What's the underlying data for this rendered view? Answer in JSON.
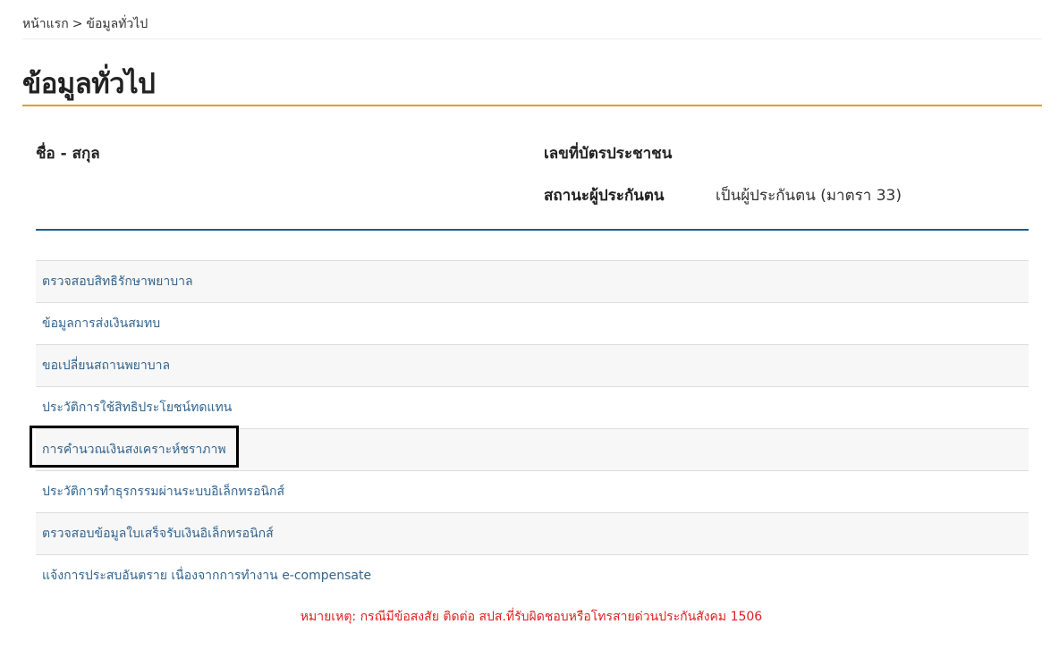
{
  "breadcrumb": {
    "home": "หน้าแรก",
    "separator": ">",
    "current": "ข้อมูลทั่วไป"
  },
  "page_title": "ข้อมูลทั่วไป",
  "info": {
    "name_label": "ชื่อ - สกุล",
    "name_value": "",
    "id_label": "เลขที่บัตรประชาชน",
    "id_value": "",
    "status_label": "สถานะผู้ประกันตน",
    "status_value": "เป็นผู้ประกันตน (มาตรา 33)"
  },
  "menu": [
    {
      "label": "ตรวจสอบสิทธิรักษาพยาบาล"
    },
    {
      "label": "ข้อมูลการส่งเงินสมทบ"
    },
    {
      "label": "ขอเปลี่ยนสถานพยาบาล"
    },
    {
      "label": "ประวัติการใช้สิทธิประโยชน์ทดแทน"
    },
    {
      "label": "การคำนวณเงินสงเคราะห์ชราภาพ"
    },
    {
      "label": "ประวัติการทำธุรกรรมผ่านระบบอิเล็กทรอนิกส์"
    },
    {
      "label": "ตรวจสอบข้อมูลใบเสร็จรับเงินอิเล็กทรอนิกส์"
    },
    {
      "label": "แจ้งการประสบอันตราย เนื่องจากการทำงาน e-compensate"
    }
  ],
  "note": "หมายเหตุ: กรณีมีข้อสงสัย ติดต่อ สปส.ที่รับผิดชอบหรือโทรสายด่วนประกันสังคม 1506",
  "colors": {
    "title_rule": "#d9a422",
    "info_rule": "#1f5c8b",
    "link": "#33658f",
    "note": "#e02020"
  }
}
